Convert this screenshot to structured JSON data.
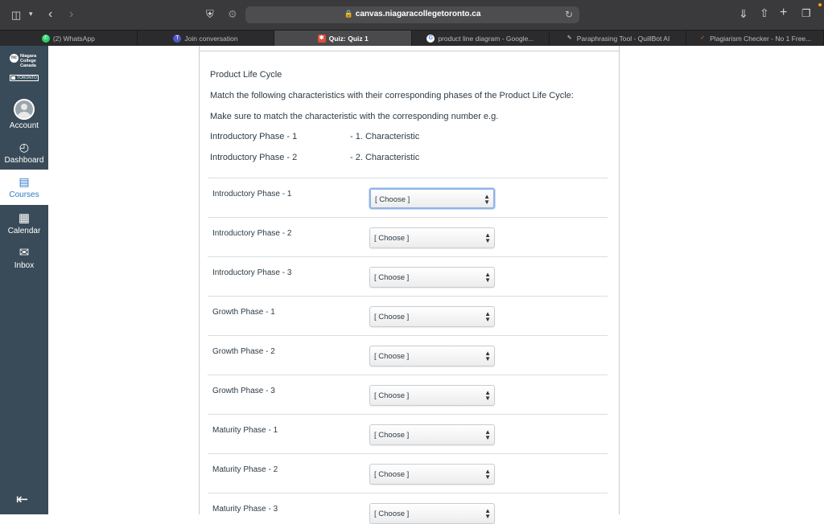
{
  "browser": {
    "url": "canvas.niagaracollegetoronto.ca",
    "tabs": [
      {
        "label": "(2) WhatsApp",
        "favicon": "whatsapp-icon",
        "active": false
      },
      {
        "label": "Join conversation",
        "favicon": "teams-icon",
        "active": false
      },
      {
        "label": "Quiz: Quiz 1",
        "favicon": "canvas-icon",
        "active": true
      },
      {
        "label": "product line diagram - Google...",
        "favicon": "google-icon",
        "active": false
      },
      {
        "label": "Paraphrasing Tool - QuillBot AI",
        "favicon": "quillbot-icon",
        "active": false
      },
      {
        "label": "Plagiarism Checker - No 1 Free...",
        "favicon": "plagiarism-icon",
        "active": false
      }
    ]
  },
  "logo": {
    "line1": "Niagara",
    "line2": "College",
    "line3": "Canada",
    "line4": "TORONTO"
  },
  "sidebar": {
    "items": [
      {
        "label": "Account",
        "icon": "avatar-icon"
      },
      {
        "label": "Dashboard",
        "icon": "dashboard-icon"
      },
      {
        "label": "Courses",
        "icon": "courses-icon",
        "active": true
      },
      {
        "label": "Calendar",
        "icon": "calendar-icon"
      },
      {
        "label": "Inbox",
        "icon": "inbox-icon"
      }
    ]
  },
  "question": {
    "title": "Product Life Cycle",
    "instruction": "Match the following characteristics with their corresponding phases of the Product Life Cycle:",
    "note": "Make sure to match the characteristic with the corresponding number e.g.",
    "examples": [
      {
        "left": "Introductory  Phase - 1",
        "right": "- 1. Characteristic"
      },
      {
        "left": "Introductory  Phase  - 2",
        "right": "- 2. Characteristic"
      }
    ],
    "rows": [
      {
        "label": "Introductory Phase - 1",
        "value": "[ Choose ]"
      },
      {
        "label": "Introductory Phase - 2",
        "value": "[ Choose ]"
      },
      {
        "label": "Introductory Phase - 3",
        "value": "[ Choose ]"
      },
      {
        "label": "Growth  Phase - 1",
        "value": "[ Choose ]"
      },
      {
        "label": "Growth  Phase - 2",
        "value": "[ Choose ]"
      },
      {
        "label": "Growth  Phase - 3",
        "value": "[ Choose ]"
      },
      {
        "label": "Maturity Phase - 1",
        "value": "[ Choose ]"
      },
      {
        "label": "Maturity Phase - 2",
        "value": "[ Choose ]"
      },
      {
        "label": "Maturity Phase - 3",
        "value": "[ Choose ]"
      }
    ]
  },
  "colors": {
    "sidebar_bg": "#394b58",
    "active_link": "#2d7bc4",
    "focus_ring": "#90b4e6"
  }
}
